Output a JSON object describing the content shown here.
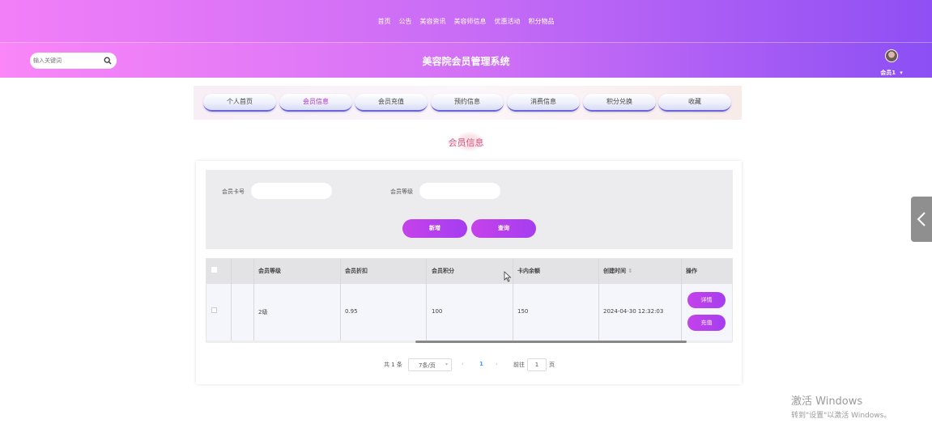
{
  "top_nav": {
    "items": [
      "首页",
      "公告",
      "美容资讯",
      "美容师信息",
      "优惠活动",
      "积分物品"
    ]
  },
  "header": {
    "search_placeholder": "输入关键词",
    "title": "美容院会员管理系统",
    "user_name": "会员1"
  },
  "tabs": {
    "items": [
      "个人首页",
      "会员信息",
      "会员充值",
      "预约信息",
      "消费信息",
      "积分兑换",
      "收藏"
    ],
    "active_index": 1
  },
  "section": {
    "title": "会员信息"
  },
  "filter": {
    "card_label": "会员卡号",
    "level_label": "会员等级",
    "card_value": "",
    "level_value": "",
    "btn_add": "新增",
    "btn_query": "查询"
  },
  "table": {
    "headers": [
      "会员等级",
      "会员折扣",
      "会员积分",
      "卡内余额",
      "创建时间",
      "操作"
    ],
    "rows": [
      {
        "level": "2级",
        "discount": "0.95",
        "points": "100",
        "balance": "150",
        "created": "2024-04-30 12:32:03",
        "btn_detail": "详情",
        "btn_recharge": "充值"
      }
    ],
    "scroll_fraction": 0.52
  },
  "pagination": {
    "total": "共 1 条",
    "page_size": "7条/页",
    "current_page": "1",
    "goto_label": "前往",
    "goto_value": "1",
    "page_suffix": "页"
  },
  "watermark": {
    "line1": "激活 Windows",
    "line2": "转到\"设置\"以激活 Windows。"
  },
  "colors": {
    "accent": "#b02fd2",
    "button": "#b43fee",
    "header_from": "#f37ff8",
    "header_to": "#8f4ff4"
  }
}
